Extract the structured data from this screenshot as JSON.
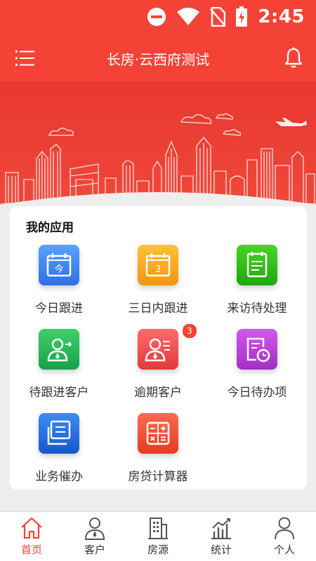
{
  "status_bar": {
    "time": "2:45",
    "icons": [
      "do-not-disturb-icon",
      "wifi-icon",
      "no-sim-icon",
      "battery-charging-icon"
    ]
  },
  "app_bar": {
    "title": "长房·云西府测试",
    "left_icon": "menu-icon",
    "right_icon": "bell-icon"
  },
  "apps_card": {
    "title": "我的应用",
    "items": [
      {
        "label": "今日跟进",
        "icon": "calendar-today-icon",
        "color": "#3b82f0",
        "glyph": "今"
      },
      {
        "label": "三日内跟进",
        "icon": "calendar-three-days-icon",
        "color": "#f7a21b",
        "glyph": "3"
      },
      {
        "label": "来访待处理",
        "icon": "visit-list-icon",
        "color": "#2ebd16"
      },
      {
        "label": "待跟进客户",
        "icon": "customer-follow-icon",
        "color": "#22b45a"
      },
      {
        "label": "逾期客户",
        "icon": "overdue-customer-icon",
        "color": "#ef4b4b",
        "badge": "3"
      },
      {
        "label": "今日待办项",
        "icon": "todo-clock-icon",
        "color": "#b63fd6"
      },
      {
        "label": "业务催办",
        "icon": "business-urge-icon",
        "color": "#1f6fe0"
      },
      {
        "label": "房贷计算器",
        "icon": "calculator-icon",
        "color": "#f2452e"
      }
    ]
  },
  "bottom_nav": {
    "active_color": "#f44336",
    "items": [
      {
        "label": "首页",
        "icon": "home-icon",
        "active": true
      },
      {
        "label": "客户",
        "icon": "customer-icon",
        "active": false
      },
      {
        "label": "房源",
        "icon": "building-icon",
        "active": false
      },
      {
        "label": "统计",
        "icon": "stats-icon",
        "active": false
      },
      {
        "label": "个人",
        "icon": "profile-icon",
        "active": false
      }
    ]
  }
}
